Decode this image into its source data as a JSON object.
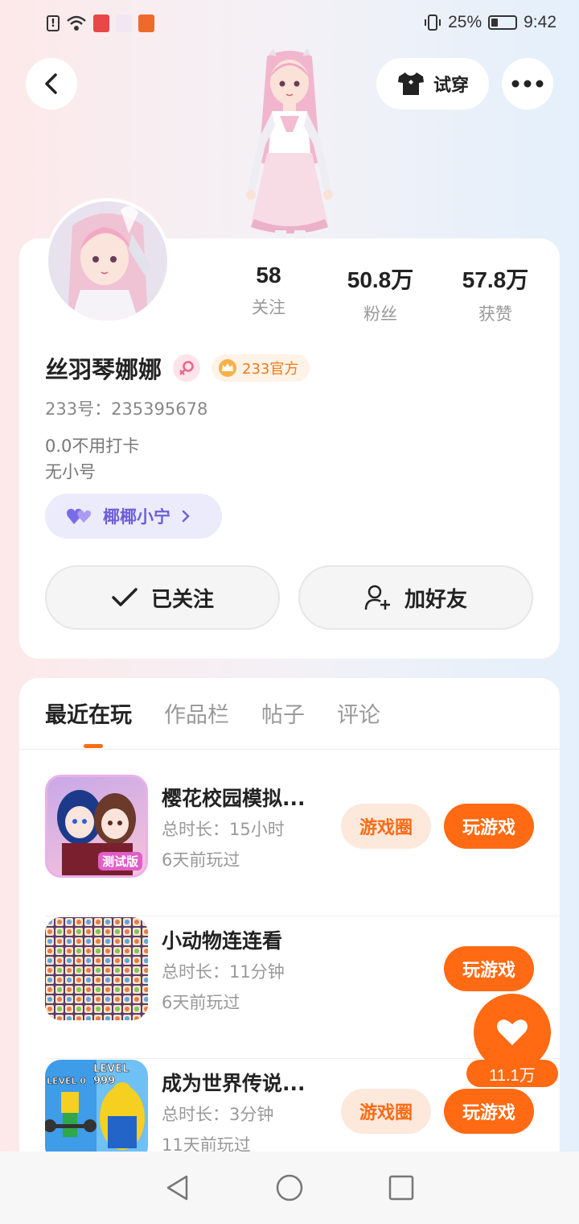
{
  "status_bar": {
    "battery": "25%",
    "time": "9:42"
  },
  "header": {
    "tryon_label": "试穿"
  },
  "profile": {
    "stats": [
      {
        "value": "58",
        "label": "关注"
      },
      {
        "value": "50.8万",
        "label": "粉丝"
      },
      {
        "value": "57.8万",
        "label": "获赞"
      }
    ],
    "name": "丝羽琴娜娜",
    "official_badge": "233官方",
    "uid": "233号：235395678",
    "bio_lines": [
      "0.0不用打卡",
      "无小号"
    ],
    "relation_tag": "椰椰小宁",
    "follow_label": "已关注",
    "add_friend_label": "加好友"
  },
  "tabs": [
    "最近在玩",
    "作品栏",
    "帖子",
    "评论"
  ],
  "games": [
    {
      "title": "樱花校园模拟...",
      "duration": "总时长：15小时",
      "last_played": "6天前玩过",
      "circle_label": "游戏圈",
      "play_label": "玩游戏",
      "icon_badge": "测试版"
    },
    {
      "title": "小动物连连看",
      "duration": "总时长：11分钟",
      "last_played": "6天前玩过",
      "play_label": "玩游戏"
    },
    {
      "title": "成为世界传说...",
      "duration": "总时长：3分钟",
      "last_played": "11天前玩过",
      "circle_label": "游戏圈",
      "play_label": "玩游戏",
      "icon_left_text": "LEVEL 0",
      "icon_right_text": "LEVEL 999"
    }
  ],
  "like": {
    "count": "11.1万"
  },
  "colors": {
    "accent": "#ff6a13",
    "purple": "#6c5fd8"
  }
}
